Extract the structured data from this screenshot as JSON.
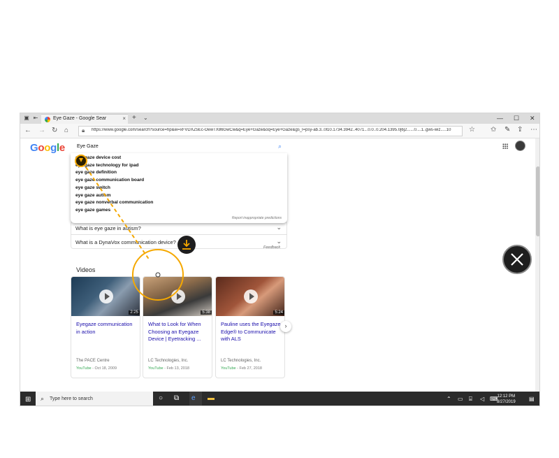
{
  "browser": {
    "tab_title": "Eye Gaze - Google Sear",
    "tab_close": "×",
    "new_tab": "+",
    "tab_list": "⌄",
    "url": "https://www.google.com/search?source=hp&ei=xFVDXZ5Ec-OewTX86GwCw&q=Eye+Gaze&oq=Eye+Gaze&gs_l=psy-ab.3..0l10.1734.3942..4071...0.0..0.204.1395.0j6j2......0....1..gws-wiz.....10",
    "window_controls": [
      "—",
      "☐",
      "✕"
    ]
  },
  "search": {
    "logo_letters": [
      {
        "char": "G",
        "color": "#4285f4"
      },
      {
        "char": "o",
        "color": "#ea4335"
      },
      {
        "char": "o",
        "color": "#fbbc05"
      },
      {
        "char": "g",
        "color": "#4285f4"
      },
      {
        "char": "l",
        "color": "#34a853"
      },
      {
        "char": "e",
        "color": "#ea4335"
      }
    ],
    "query": "Eye Gaze",
    "suggestions": [
      {
        "prefix": "eye gaze",
        "rest": " device cost"
      },
      {
        "prefix": "eye gaze",
        "rest": " technology for ipad"
      },
      {
        "prefix": "eye gaze",
        "rest": " definition"
      },
      {
        "prefix": "eye gaze",
        "rest": " communication board"
      },
      {
        "prefix": "eye gaze",
        "rest": " switch"
      },
      {
        "prefix": "eye gaze",
        "rest": " autism"
      },
      {
        "prefix": "eye gaze",
        "rest": " nonverbal communication"
      },
      {
        "prefix": "eye gaze",
        "rest": " games"
      }
    ],
    "report_link": "Report inappropriate predictions"
  },
  "people_also_ask": [
    "What is eye gaze in autism?",
    "What is a DynaVox communication device?"
  ],
  "feedback": "Feedback",
  "videos": {
    "heading": "Videos",
    "items": [
      {
        "title": "Eyegaze communication in action",
        "duration": "2:25",
        "source": "The PACE Centre",
        "platform": "YouTube",
        "date": "- Oct 18, 2009"
      },
      {
        "title": "What to Look for When Choosing an Eyegaze Device | Eyetracking ...",
        "duration": "5:38",
        "source": "LC Technologies, Inc.",
        "platform": "YouTube",
        "date": "- Feb 13, 2018"
      },
      {
        "title": "Pauline uses the Eyegaze Edge® to Communicate with ALS",
        "duration": "5:24",
        "source": "LC Technologies, Inc.",
        "platform": "YouTube",
        "date": "- Feb 27, 2018"
      }
    ]
  },
  "taskbar": {
    "search_placeholder": "Type here to search",
    "time": "12:12 PM",
    "date": "8/27/2019"
  },
  "colors": {
    "gaze_accent": "#f5a800",
    "link": "#1a0dab",
    "overlay_button": "#1e1e1e"
  }
}
